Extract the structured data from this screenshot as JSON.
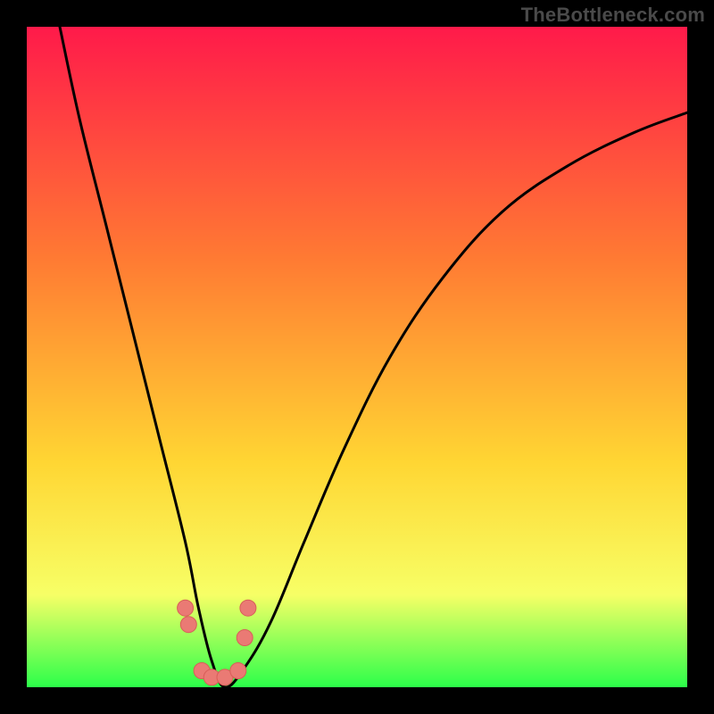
{
  "watermark": "TheBottleneck.com",
  "chart_data": {
    "type": "line",
    "title": "",
    "xlabel": "",
    "ylabel": "",
    "xlim": [
      0,
      100
    ],
    "ylim": [
      0,
      100
    ],
    "grid": false,
    "legend": false,
    "background_gradient_colors": [
      "#ff1a4a",
      "#ff7a33",
      "#ffd633",
      "#f7ff66",
      "#2bff4a"
    ],
    "background_gradient_stops": [
      0,
      35,
      66,
      86,
      100
    ],
    "series": [
      {
        "name": "bottleneck-curve",
        "x": [
          5,
          8,
          12,
          16,
          20,
          24,
          26,
          28,
          30,
          33,
          37,
          42,
          48,
          55,
          63,
          72,
          82,
          92,
          100
        ],
        "y": [
          100,
          86,
          70,
          54,
          38,
          22,
          12,
          4,
          0,
          3,
          10,
          22,
          36,
          50,
          62,
          72,
          79,
          84,
          87
        ]
      }
    ],
    "markers": [
      {
        "name": "marker-1",
        "x": 24.0,
        "y": 12.0
      },
      {
        "name": "marker-2",
        "x": 24.5,
        "y": 9.5
      },
      {
        "name": "marker-3",
        "x": 26.5,
        "y": 2.5
      },
      {
        "name": "marker-4",
        "x": 28.0,
        "y": 1.5
      },
      {
        "name": "marker-5",
        "x": 30.0,
        "y": 1.5
      },
      {
        "name": "marker-6",
        "x": 32.0,
        "y": 2.5
      },
      {
        "name": "marker-7",
        "x": 33.0,
        "y": 7.5
      },
      {
        "name": "marker-8",
        "x": 33.5,
        "y": 12.0
      }
    ],
    "colors": {
      "curve": "#000000",
      "marker_fill": "#ea7a74",
      "marker_stroke": "#d85e58"
    }
  }
}
